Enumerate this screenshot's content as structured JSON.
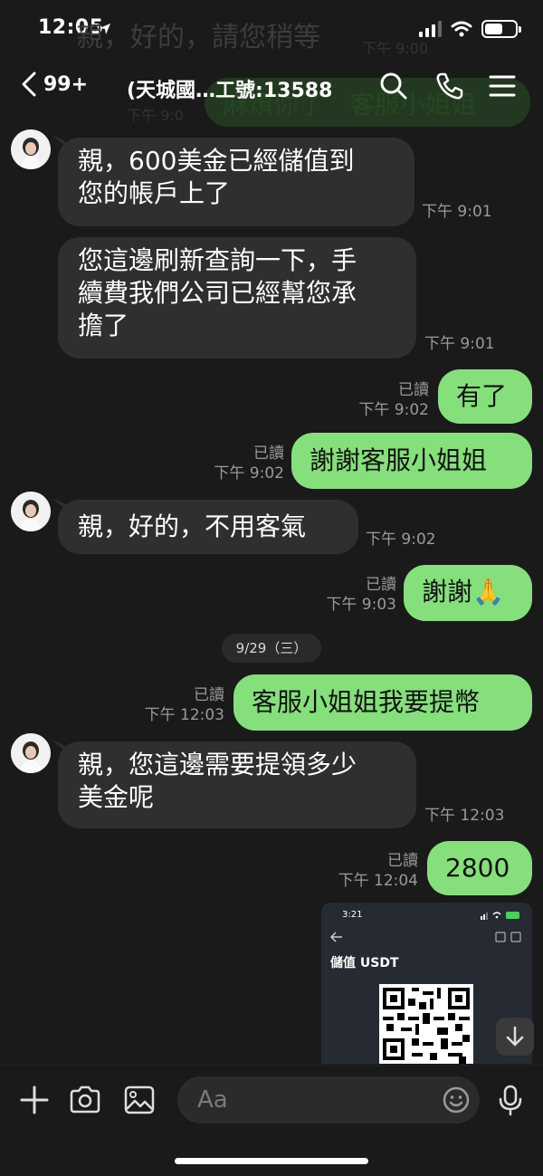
{
  "status_bar": {
    "time": "12:05",
    "battery_level": 0.6
  },
  "background_ghost": {
    "top_text": "親，好的，請您稍等",
    "top_time": "下午 9:00",
    "bubble_text": "麻煩你了　客服小姐姐",
    "stamp": "下午 9:0"
  },
  "header": {
    "unread_count": "99+",
    "title": "(天城國…工號:13588",
    "icons": [
      "search-icon",
      "phone-icon",
      "menu-icon"
    ]
  },
  "messages": [
    {
      "direction": "in",
      "text": "親，600美金已經儲值到\n您的帳戶上了",
      "time": "下午 9:01"
    },
    {
      "direction": "in",
      "text": "您這邊刷新查詢一下，手\n續費我們公司已經幫您承\n擔了",
      "time": "下午 9:01"
    },
    {
      "direction": "out",
      "text": "有了",
      "read": "已讀",
      "time": "下午 9:02"
    },
    {
      "direction": "out",
      "text": "謝謝客服小姐姐",
      "read": "已讀",
      "time": "下午 9:02"
    },
    {
      "direction": "in",
      "text": "親，好的，不用客氣",
      "time": "下午 9:02"
    },
    {
      "direction": "out",
      "text": "謝謝🙏",
      "read": "已讀",
      "time": "下午 9:03"
    },
    {
      "direction": "out",
      "text": "客服小姐姐我要提幣",
      "read": "已讀",
      "time": "下午 12:03"
    },
    {
      "direction": "in",
      "text": "親，您這邊需要提領多少\n美金呢",
      "time": "下午 12:03"
    },
    {
      "direction": "out",
      "text": "2800",
      "read": "已讀",
      "time": "下午 12:04"
    }
  ],
  "date_separator": "9/29（三）",
  "image_message": {
    "status_time": "3:21",
    "title": "儲值 USDT"
  },
  "input_bar": {
    "placeholder": "Aa",
    "icons": [
      "plus-icon",
      "camera-icon",
      "image-icon",
      "emoji-icon",
      "microphone-icon"
    ]
  },
  "colors": {
    "background": "#1a1a1a",
    "incoming_bubble": "#2f2f2f",
    "outgoing_bubble": "#85e07b",
    "meta_text": "#9a9a9a"
  }
}
